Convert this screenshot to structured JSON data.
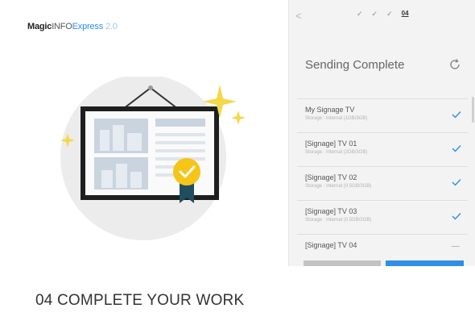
{
  "brand": {
    "part1": "Magic",
    "part2": "INFO",
    "part3": "Express",
    "version": "2.0"
  },
  "nav": {
    "back_glyph": "<",
    "steps": [
      "✓",
      "✓",
      "✓",
      "04"
    ],
    "icon": "chevron-left-icon"
  },
  "panel": {
    "title": "Sending Complete",
    "refresh_icon": "refresh-icon",
    "devices": [
      {
        "name": "My Signage TV",
        "storage": "Storage : Internal (1GB/3GB)",
        "status": "check-icon"
      },
      {
        "name": "[Signage] TV 01",
        "storage": "Storage : Internal (2GB/3GB)",
        "status": "check-icon"
      },
      {
        "name": "[Signage] TV 02",
        "storage": "Storage : Internal (0.5GB/3GB)",
        "status": "check-icon"
      },
      {
        "name": "[Signage] TV 03",
        "storage": "Storage : Internal (0.5GB/2GB)",
        "status": "check-icon"
      },
      {
        "name": "[Signage] TV 04",
        "storage": "",
        "status": "pending"
      }
    ]
  },
  "colors": {
    "accent": "#2f8fe6",
    "gold": "#f5c518",
    "panel_bg": "#f3f3f3"
  },
  "caption": "04 COMPLETE YOUR WORK"
}
